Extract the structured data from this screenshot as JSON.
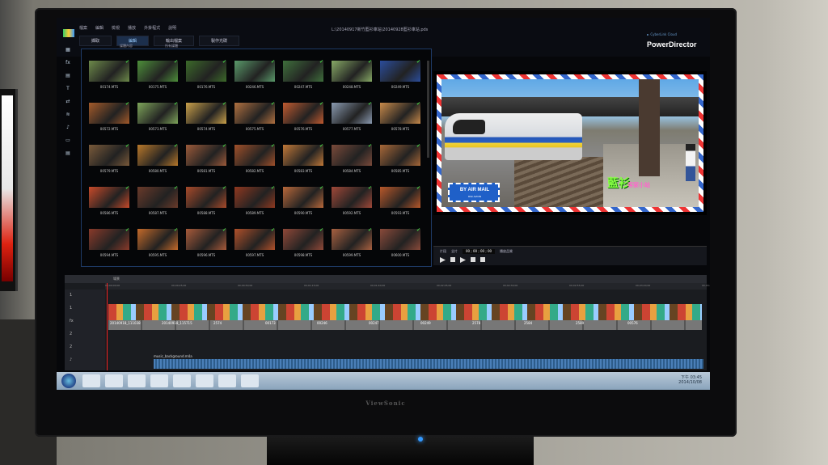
{
  "app": {
    "file_path": "L:\\20140917新竹藍衫車站\\20140928藍衫車站.pds",
    "brand_name": "PowerDirector",
    "brand_sub": "► CyberLink Cloud",
    "menu": [
      "檔案",
      "編輯",
      "檢視",
      "播放",
      "外掛程式",
      "說明"
    ],
    "tabs": [
      {
        "label": "擷取",
        "active": false
      },
      {
        "label": "編輯",
        "active": true
      },
      {
        "label": "輸出檔案",
        "active": false
      },
      {
        "label": "製作光碟",
        "active": false
      }
    ]
  },
  "left_tools": [
    "media-icon",
    "fx-icon",
    "pip-icon",
    "title-icon",
    "transition-icon",
    "audio-mix-icon",
    "voice-icon",
    "chapter-icon",
    "subtitle-icon"
  ],
  "left_tool_glyphs": [
    "▦",
    "fx",
    "▤",
    "T",
    "⇄",
    "≋",
    "♪",
    "▭",
    "▤"
  ],
  "library": {
    "filter_label": "媒體內容",
    "sort_label": "所有媒體",
    "clips": [
      "00174.MTS",
      "00175.MTS",
      "00176.MTS",
      "00246.MTS",
      "00247.MTS",
      "00248.MTS",
      "00249.MTS",
      "00572.MTS",
      "00573.MTS",
      "00574.MTS",
      "00575.MTS",
      "00576.MTS",
      "00577.MTS",
      "00578.MTS",
      "00579.MTS",
      "00580.MTS",
      "00581.MTS",
      "00582.MTS",
      "00583.MTS",
      "00584.MTS",
      "00585.MTS",
      "00586.MTS",
      "00587.MTS",
      "00588.MTS",
      "00589.MTS",
      "00590.MTS",
      "00592.MTS",
      "00593.MTS",
      "00594.MTS",
      "00595.MTS",
      "00596.MTS",
      "00597.MTS",
      "00598.MTS",
      "00599.MTS",
      "00600.MTS"
    ],
    "thumb_colors": [
      "#6d8a4a",
      "#4d8f3a",
      "#3c6a2a",
      "#5a9a6a",
      "#3f6f3c",
      "#88aa66",
      "#2b4d9c",
      "#a35a2a",
      "#7ea55a",
      "#caa04a",
      "#b07040",
      "#c05a30",
      "#8a9ab0",
      "#c88a4a",
      "#7a5a3a",
      "#b8782a",
      "#9c5a3a",
      "#a0502a",
      "#c07838",
      "#7a4a3a",
      "#a86838",
      "#c84a2a",
      "#6a3a2a",
      "#a84a2a",
      "#903820",
      "#b8683a",
      "#a04838",
      "#b8582a",
      "#8a3a2a",
      "#c46a2a",
      "#a85a3a",
      "#b0502a",
      "#904838",
      "#a86040",
      "#8a4a3a"
    ]
  },
  "preview": {
    "stamp_title": "BY AIR MAIL",
    "stamp_sub": "PAR AVION",
    "caption": "藍衫",
    "caption2": "客家小站",
    "controls": {
      "mode_a": "片段",
      "mode_b": "全片",
      "timecode": "00 ; 00 ; 00 ; 00",
      "quality": "播放品質"
    }
  },
  "timeline": {
    "header_label": "場景",
    "ruler_ticks": [
      "00;00;00;00",
      "00;00;25;00",
      "00;00;50;00",
      "00;01;15;00",
      "00;01;40;00",
      "00;02;05;00",
      "00;02;30;00",
      "00;02;55;00",
      "00;03;20;00",
      "00;03;45;00"
    ],
    "track_labels": [
      "1",
      "1",
      "fx",
      "2",
      "2",
      "♪"
    ],
    "clip_labels": [
      "20140918_111038",
      "20140918_115715",
      "2574",
      "00173",
      "00246",
      "00247",
      "00249",
      "2578",
      "2584",
      "2589",
      "00576"
    ],
    "audio_label": "music_background.m4a"
  },
  "taskbar": {
    "time": "下午 03:45",
    "date": "2014/10/08",
    "icons": [
      "start-orb",
      "ie-icon",
      "folder-icon",
      "media-player-icon",
      "explorer-icon",
      "firefox-icon",
      "photo-icon",
      "powerdirector-icon",
      "app-icon"
    ]
  },
  "monitor": {
    "brand": "ViewSonic"
  },
  "colors": {
    "accent": "#1c2f4c",
    "playhead": "#e22",
    "check": "#44cc44"
  }
}
